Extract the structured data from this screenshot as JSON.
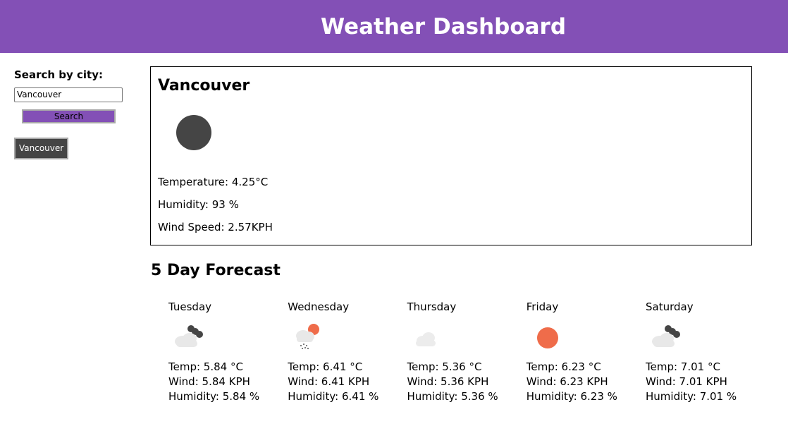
{
  "header": {
    "title": "Weather Dashboard"
  },
  "sidebar": {
    "label": "Search by city:",
    "search_value": "Vancouver",
    "search_button": "Search",
    "history": [
      "Vancouver"
    ]
  },
  "current": {
    "city": "Vancouver",
    "icon": "moon-icon",
    "temperature": "Temperature: 4.25°C",
    "humidity": "Humidity: 93 %",
    "wind": "Wind Speed: 2.57KPH"
  },
  "forecast": {
    "title": "5 Day Forecast",
    "days": [
      {
        "name": "Tuesday",
        "icon": "cloudy-night-icon",
        "temp": "Temp: 5.84 °C",
        "wind": "Wind: 5.84 KPH",
        "humidity": "Humidity: 5.84 %"
      },
      {
        "name": "Wednesday",
        "icon": "rain-sun-icon",
        "temp": "Temp: 6.41 °C",
        "wind": "Wind: 6.41 KPH",
        "humidity": "Humidity: 6.41 %"
      },
      {
        "name": "Thursday",
        "icon": "cloud-icon",
        "temp": "Temp: 5.36 °C",
        "wind": "Wind: 5.36 KPH",
        "humidity": "Humidity: 5.36 %"
      },
      {
        "name": "Friday",
        "icon": "sun-icon",
        "temp": "Temp: 6.23 °C",
        "wind": "Wind: 6.23 KPH",
        "humidity": "Humidity: 6.23 %"
      },
      {
        "name": "Saturday",
        "icon": "cloudy-night-icon",
        "temp": "Temp: 7.01 °C",
        "wind": "Wind: 7.01 KPH",
        "humidity": "Humidity: 7.01 %"
      }
    ]
  },
  "colors": {
    "header": "#8350b6",
    "dark": "#454545",
    "sun": "#ef6c4a",
    "cloud": "#e8e8e8"
  }
}
